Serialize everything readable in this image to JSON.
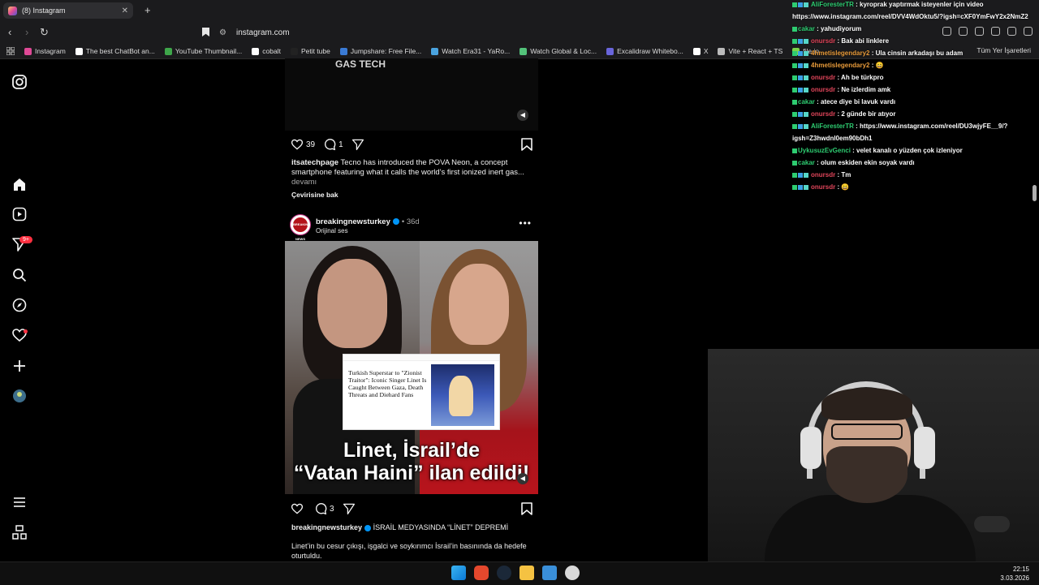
{
  "browser": {
    "tab_title": "(8) Instagram",
    "tab_close": "✕",
    "new_tab": "+",
    "url": "instagram.com",
    "back": "‹",
    "forward": "›",
    "reload": "↻"
  },
  "bookmarks": {
    "items": [
      {
        "label": "Instagram",
        "color": "#df4996"
      },
      {
        "label": "The best ChatBot an...",
        "color": "#ffffff"
      },
      {
        "label": "YouTube Thumbnail...",
        "color": "#3ea64a"
      },
      {
        "label": "cobalt",
        "color": "#ffffff"
      },
      {
        "label": "Petit tube",
        "color": "#222222"
      },
      {
        "label": "Jumpshare: Free File...",
        "color": "#3a7bd5"
      },
      {
        "label": "Watch Era31 - YaRo...",
        "color": "#4aa3df"
      },
      {
        "label": "Watch Global & Loc...",
        "color": "#53c27a"
      },
      {
        "label": "Excalidraw Whitebo...",
        "color": "#6965db"
      },
      {
        "label": "X",
        "color": "#ffffff"
      },
      {
        "label": "Vite + React + TS",
        "color": "#bbbbbb"
      },
      {
        "label": "file.io",
        "color": "#7bd34a"
      }
    ],
    "all_bookmarks": "Tüm Yer İşaretleri"
  },
  "sidebar": {
    "notifications_badge": "9+"
  },
  "post1": {
    "top_text": "GAS TECH",
    "likes": "39",
    "comments": "1",
    "username": "itsatechpage",
    "caption": "Tecno has introduced the POVA Neon, a concept smartphone featuring what it calls the world's first ionized inert gas...",
    "more": "devamı",
    "translate": "Çevirisine bak"
  },
  "post2": {
    "username": "breakingnewsturkey",
    "age": "• 36d",
    "audio": "Orijinal ses",
    "avatar_text": "BREAKING NEWS",
    "article_headline": "Turkish Superstar to \"Zionist Traitor\": Iconic Singer Linet Is Caught Between Gaza, Death Threats and Diehard Fans",
    "overlay_line1": "Linet, İsrail’de",
    "overlay_line2": "“Vatan Haini” ilan edildi!",
    "comments": "3",
    "caption_user": "breakingnewsturkey",
    "caption_title": "İSRAİL MEDYASINDA “LİNET” DEPREMİ",
    "caption_body": "Linet’in bu cesur çıkışı, işgalci ve soykırımcı İsrail’in basınında da hedefe oturtuldu."
  },
  "chat": {
    "messages": [
      {
        "user": "AliForesterTR",
        "user_color": "#2ecc71",
        "text": "kyroprak yaptırmak isteyenler için video",
        "icons": 3
      },
      {
        "user": "",
        "user_color": "#ffffff",
        "text": "https://www.instagram.com/reel/DVV4WdOktu5/?igsh=cXF0YmFwY2x2NmZ2",
        "icons": 0
      },
      {
        "user": "cakar",
        "user_color": "#2ecc71",
        "text": "yahudiyorum",
        "icons": 1
      },
      {
        "user": "onursdr",
        "user_color": "#e0455a",
        "text": "Bak abi linklere",
        "icons": 3
      },
      {
        "user": "4hmetislegendary2",
        "user_color": "#e89b3a",
        "text": "Ula cinsin arkadaşı bu adam",
        "icons": 3
      },
      {
        "user": "4hmetislegendary2",
        "user_color": "#e89b3a",
        "text": "😄",
        "icons": 3
      },
      {
        "user": "onursdr",
        "user_color": "#e0455a",
        "text": "Ah be türkpro",
        "icons": 3
      },
      {
        "user": "onursdr",
        "user_color": "#e0455a",
        "text": "Ne izlerdim amk",
        "icons": 3
      },
      {
        "user": "cakar",
        "user_color": "#2ecc71",
        "text": "atece diye bi lavuk vardı",
        "icons": 1
      },
      {
        "user": "onursdr",
        "user_color": "#e0455a",
        "text": "2 günde bir atıyor",
        "icons": 3
      },
      {
        "user": "AliForesterTR",
        "user_color": "#2ecc71",
        "text": "https://www.instagram.com/reel/DU3wjyFE__9/?",
        "icons": 3
      },
      {
        "user": "",
        "user_color": "#ffffff",
        "text": "igsh=Z3hwdnl0em90bDh1",
        "icons": 0
      },
      {
        "user": "UykusuzEvGenci",
        "user_color": "#2ecc71",
        "text": "velet kanalı o yüzden çok izleniyor",
        "icons": 1
      },
      {
        "user": "cakar",
        "user_color": "#2ecc71",
        "text": "olum eskiden ekin soyak vardı",
        "icons": 1
      },
      {
        "user": "onursdr",
        "user_color": "#e0455a",
        "text": "Tm",
        "icons": 3
      },
      {
        "user": "onursdr",
        "user_color": "#e0455a",
        "text": "😄",
        "icons": 3
      }
    ]
  },
  "taskbar": {
    "time": "22:15",
    "date": "3.03.2026"
  }
}
